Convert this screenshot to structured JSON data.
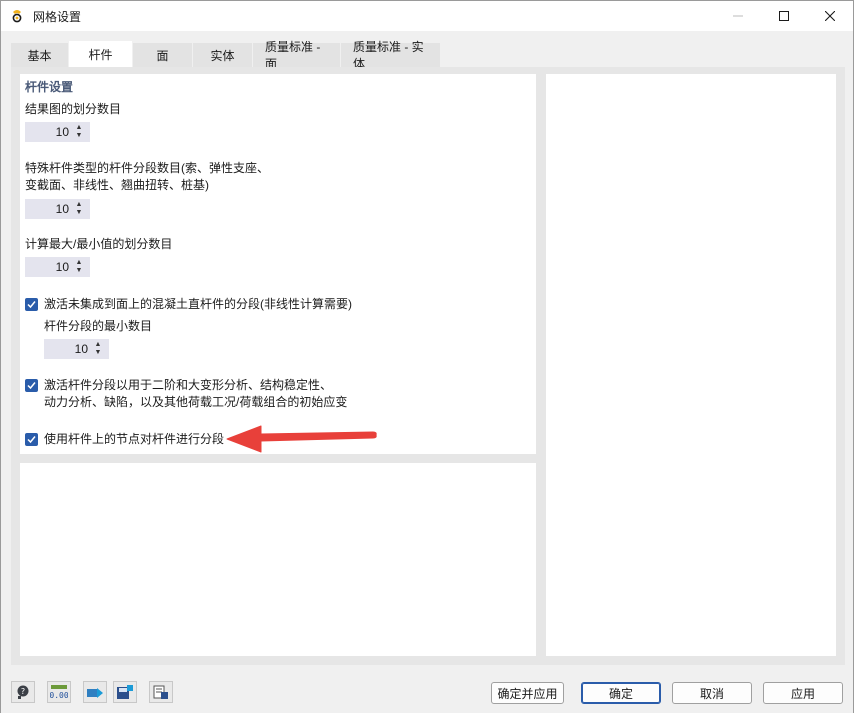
{
  "window": {
    "title": "网格设置"
  },
  "tabs": [
    {
      "label": "基本",
      "active": false
    },
    {
      "label": "杆件",
      "active": true
    },
    {
      "label": "面",
      "active": false
    },
    {
      "label": "实体",
      "active": false
    },
    {
      "label": "质量标准 - 面",
      "active": false
    },
    {
      "label": "质量标准 - 实体",
      "active": false
    }
  ],
  "settings": {
    "section_title": "杆件设置",
    "result_divisions": {
      "label": "结果图的划分数目",
      "value": "10"
    },
    "special_member_segments": {
      "label_line1": "特殊杆件类型的杆件分段数目(索、弹性支座、",
      "label_line2": "变截面、非线性、翘曲扭转、桩基)",
      "value": "10"
    },
    "minmax_divisions": {
      "label": "计算最大/最小值的划分数目",
      "value": "10"
    },
    "activate_concrete_segments": {
      "label": "激活未集成到面上的混凝土直杆件的分段(非线性计算需要)",
      "checked": true,
      "min_segments_label": "杆件分段的最小数目",
      "min_segments_value": "10"
    },
    "activate_member_segments": {
      "label_line1": "激活杆件分段以用于二阶和大变形分析、结构稳定性、",
      "label_line2": "动力分析、缺陷，以及其他荷载工况/荷载组合的初始应变",
      "checked": true
    },
    "use_nodes_on_members": {
      "label": "使用杆件上的节点对杆件进行分段",
      "checked": true
    }
  },
  "annotation": {
    "arrow_color": "#e8403a"
  },
  "colors": {
    "accent": "#2a5caa",
    "section_title": "#4a5a78"
  },
  "toolbar_icons": [
    "help-icon",
    "units-icon",
    "model-transfer-icon",
    "save-settings-icon",
    "load-settings-icon"
  ],
  "buttons": {
    "ok_apply": "确定并应用",
    "ok": "确定",
    "cancel": "取消",
    "apply": "应用"
  }
}
